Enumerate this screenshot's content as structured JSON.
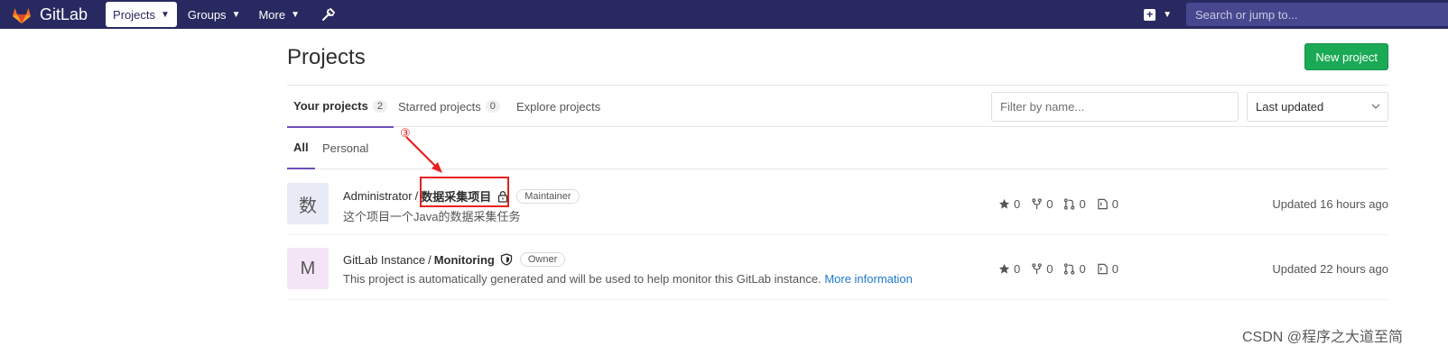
{
  "topbar": {
    "brand": "GitLab",
    "nav": [
      {
        "label": "Projects",
        "active": true
      },
      {
        "label": "Groups"
      },
      {
        "label": "More"
      }
    ],
    "search_placeholder": "Search or jump to..."
  },
  "page": {
    "title": "Projects",
    "new_project_label": "New project"
  },
  "tabs": [
    {
      "label": "Your projects",
      "count": "2",
      "active": true
    },
    {
      "label": "Starred projects",
      "count": "0"
    },
    {
      "label": "Explore projects"
    }
  ],
  "filter": {
    "placeholder": "Filter by name..."
  },
  "sort": {
    "selected": "Last updated"
  },
  "subtabs": [
    {
      "label": "All",
      "active": true
    },
    {
      "label": "Personal"
    }
  ],
  "projects": [
    {
      "avatar_letter": "数",
      "avatar_color": "#e8eaf6",
      "namespace": "Administrator",
      "name": "数据采集项目",
      "visibility_icon": "lock-icon",
      "role": "Maintainer",
      "description": "这个项目一个Java的数据采集任务",
      "stars": "0",
      "forks": "0",
      "merge_requests": "0",
      "issues": "0",
      "updated": "Updated 16 hours ago"
    },
    {
      "avatar_letter": "M",
      "avatar_color": "#f3e5f5",
      "namespace": "GitLab Instance",
      "name": "Monitoring",
      "visibility_icon": "shield-icon",
      "role": "Owner",
      "description": "This project is automatically generated and will be used to help monitor this GitLab instance.",
      "description_link": "More information",
      "stars": "0",
      "forks": "0",
      "merge_requests": "0",
      "issues": "0",
      "updated": "Updated 22 hours ago"
    }
  ],
  "annotation": {
    "marker": "③",
    "color": "#e8201f"
  },
  "watermark": "CSDN @程序之大道至简",
  "colors": {
    "topbar": "#292961",
    "accent": "#6b4fbb",
    "success": "#1aaa55",
    "link": "#1f78d1"
  }
}
